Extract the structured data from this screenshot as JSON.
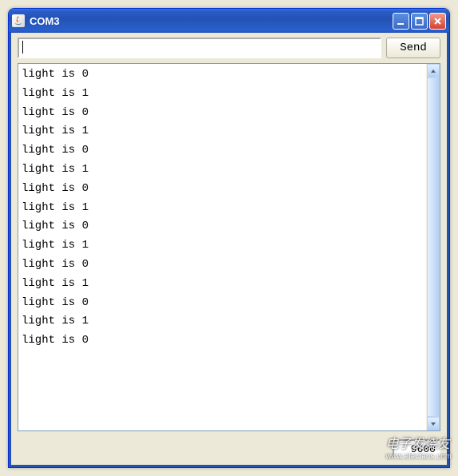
{
  "window": {
    "title": "COM3"
  },
  "toolbar": {
    "input_value": "",
    "send_label": "Send"
  },
  "console": {
    "lines": [
      "light is 0",
      "light is 1",
      "light is 0",
      "light is 1",
      "light is 0",
      "light is 1",
      "light is 0",
      "light is 1",
      "light is 0",
      "light is 1",
      "light is 0",
      "light is 1",
      "light is 0",
      "light is 1",
      "light is 0"
    ]
  },
  "footer": {
    "baud_value": "9600"
  },
  "watermark": {
    "main": "电子发烧友",
    "sub": "www.elecfans.com"
  }
}
